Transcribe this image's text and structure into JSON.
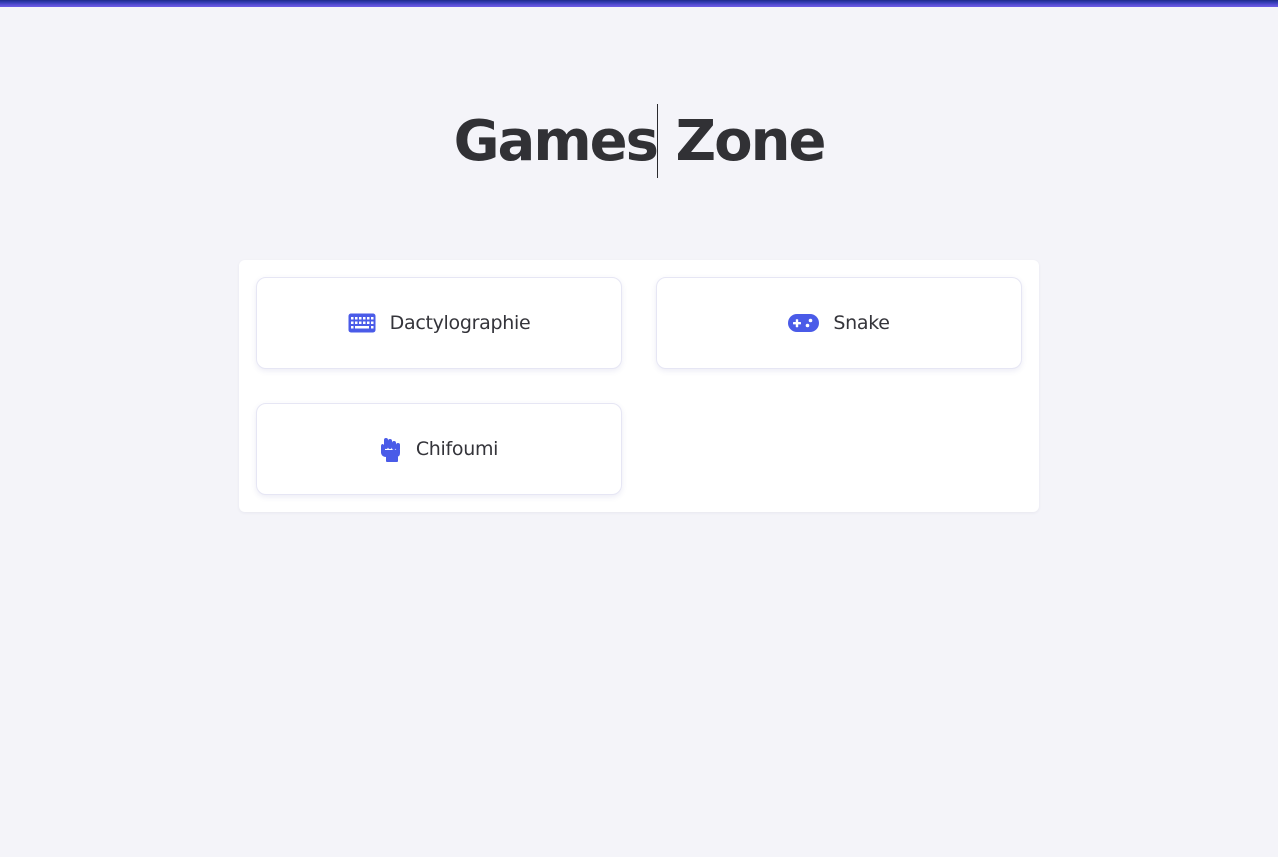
{
  "header": {
    "title_part1": "Games",
    "title_part2": " Zone"
  },
  "games": [
    {
      "label": "Dactylographie",
      "icon": "keyboard-icon"
    },
    {
      "label": "Snake",
      "icon": "gamepad-icon"
    },
    {
      "label": "Chifoumi",
      "icon": "fist-icon"
    }
  ],
  "colors": {
    "accent": "#4a5be8",
    "background": "#f4f4f9",
    "text": "#313135"
  }
}
